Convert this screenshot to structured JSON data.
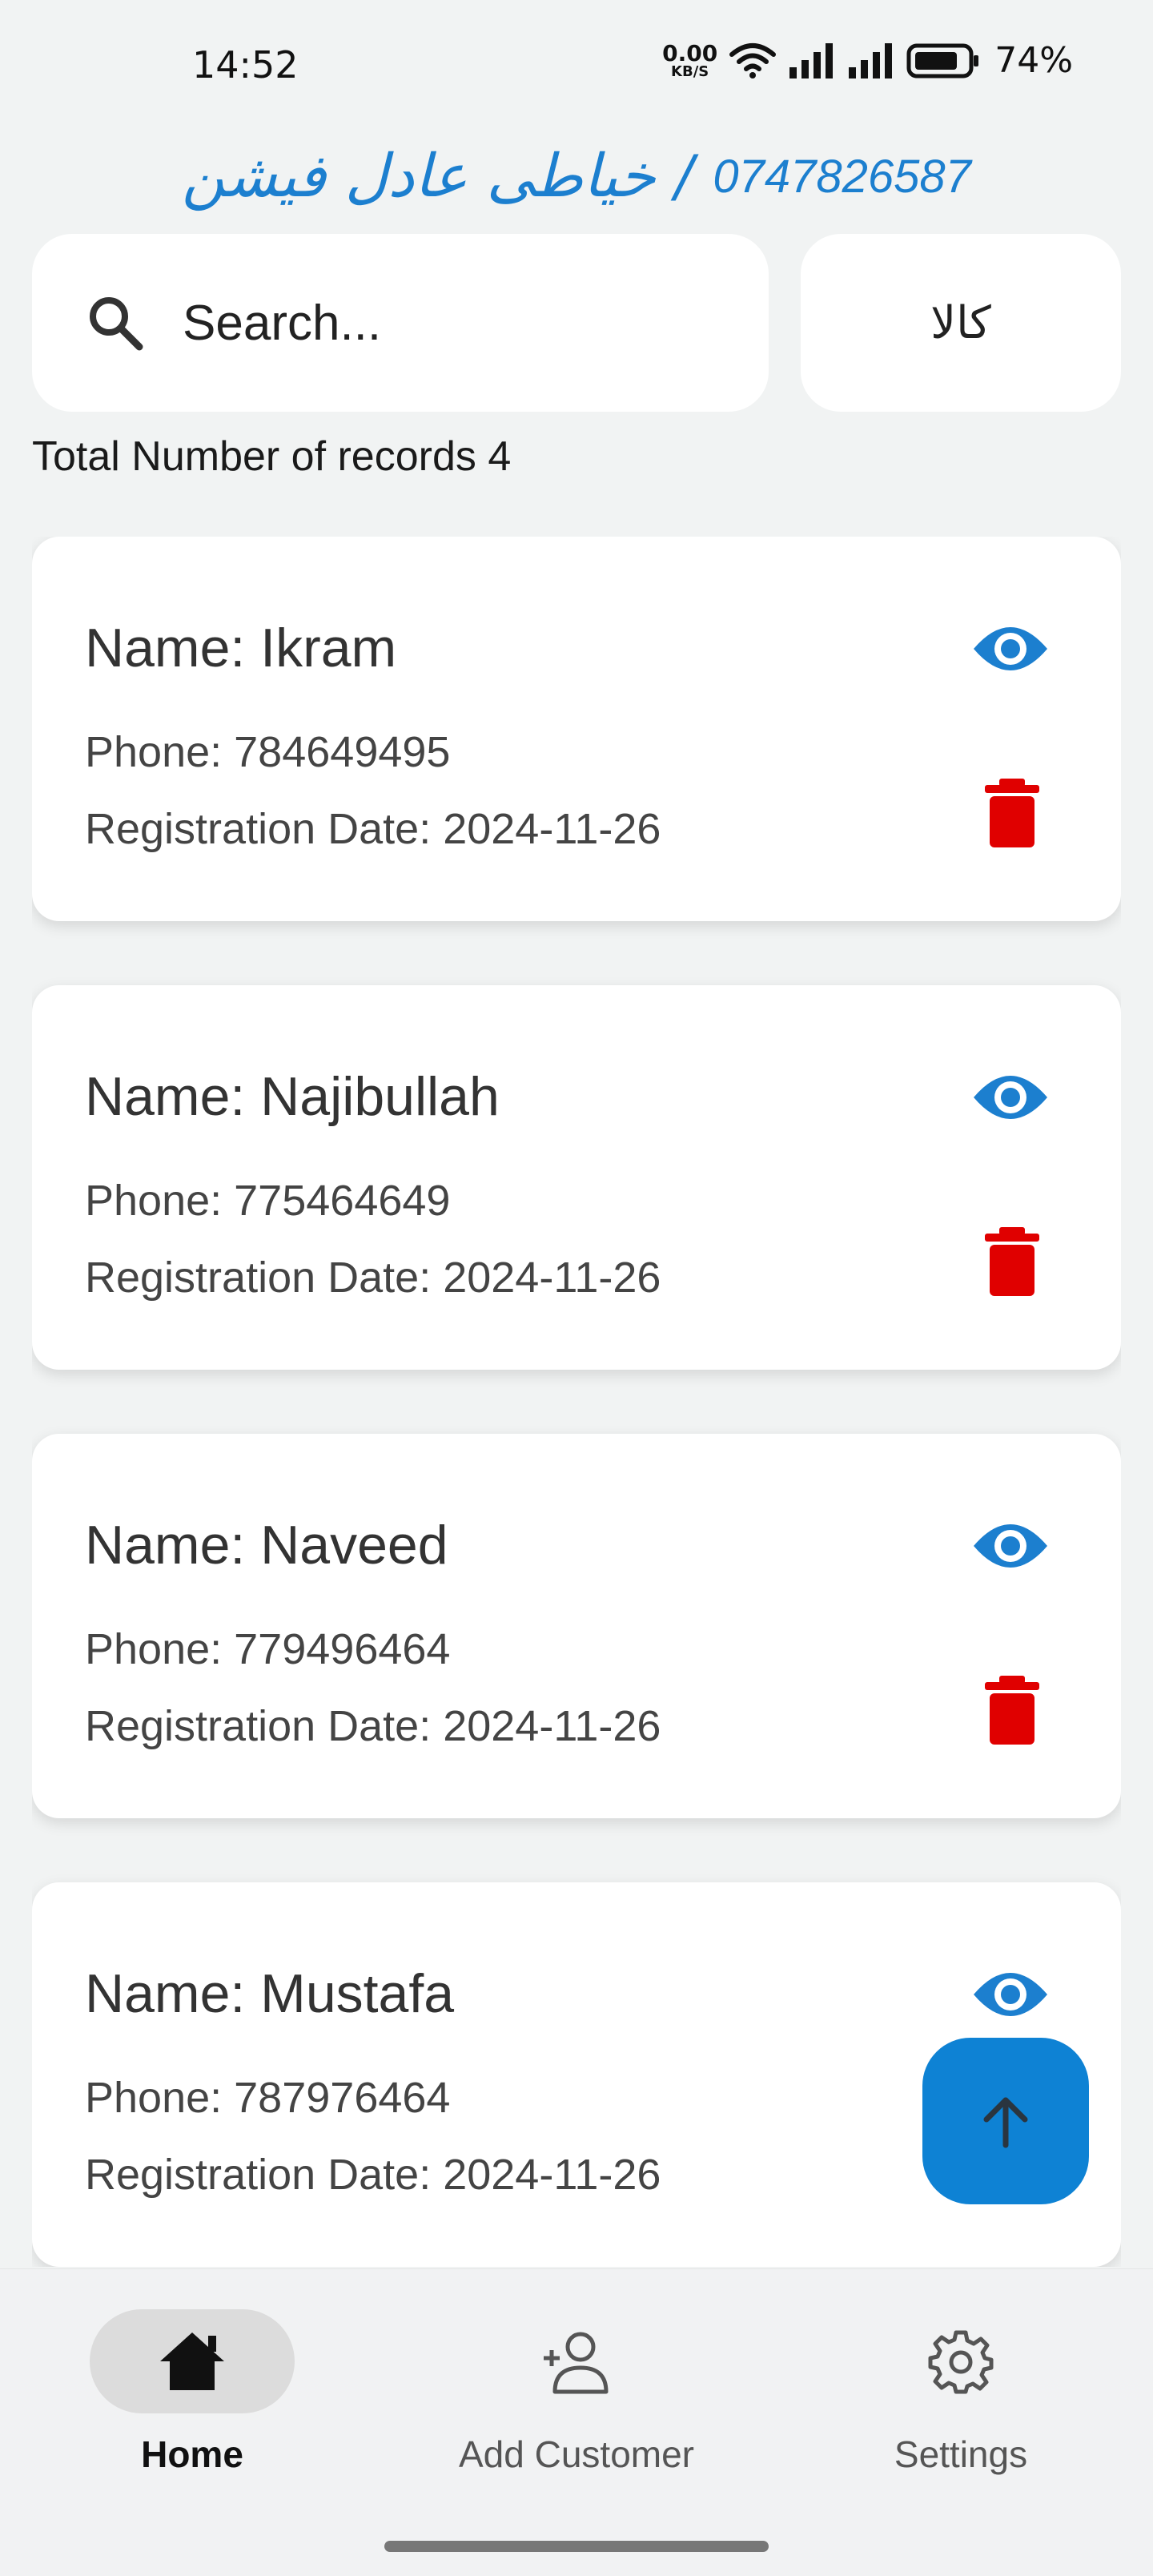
{
  "status_bar": {
    "time": "14:52",
    "net_speed_value": "0.00",
    "net_speed_unit": "KB/S",
    "battery_percent": "74%"
  },
  "header": {
    "shop_name": "خیاطی عادل فیشن",
    "separator": "/",
    "phone": "0747826587"
  },
  "search": {
    "placeholder": "Search...",
    "value": ""
  },
  "filter_button": {
    "label": "کالا"
  },
  "summary": {
    "total_label": "Total Number of records 4"
  },
  "customers": [
    {
      "name": "Name: Ikram",
      "phone": "Phone: 784649495",
      "date": "Registration Date: 2024-11-26"
    },
    {
      "name": "Name: Najibullah",
      "phone": "Phone: 775464649",
      "date": "Registration Date: 2024-11-26"
    },
    {
      "name": "Name: Naveed",
      "phone": "Phone: 779496464",
      "date": "Registration Date: 2024-11-26"
    },
    {
      "name": "Name: Mustafa",
      "phone": "Phone: 787976464",
      "date": "Registration Date: 2024-11-26"
    }
  ],
  "icons": {
    "view": "eye-icon",
    "delete": "trash-icon",
    "search": "search-icon",
    "scroll_top": "arrow-up-icon"
  },
  "bottom_nav": {
    "items": [
      {
        "label": "Home",
        "icon": "home-icon",
        "active": true
      },
      {
        "label": "Add Customer",
        "icon": "add-person-icon",
        "active": false
      },
      {
        "label": "Settings",
        "icon": "gear-icon",
        "active": false
      }
    ]
  },
  "colors": {
    "accent": "#0e82d4",
    "view_icon": "#1c7fcf",
    "delete_icon": "#e00000",
    "background": "#f1f3f3"
  }
}
